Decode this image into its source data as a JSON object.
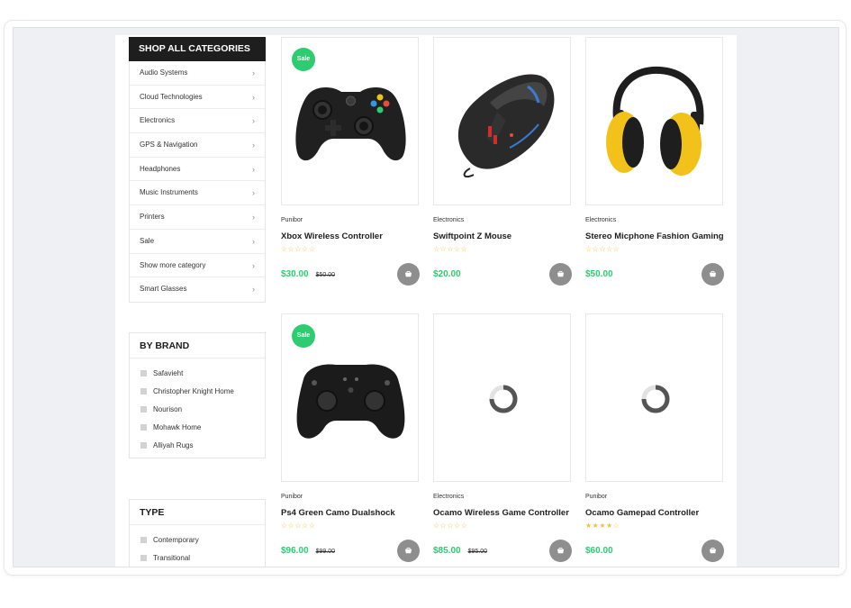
{
  "categories": {
    "title": "SHOP ALL CATEGORIES",
    "items": [
      {
        "label": "Audio Systems"
      },
      {
        "label": "Cloud Technologies"
      },
      {
        "label": "Electronics"
      },
      {
        "label": "GPS & Navigation"
      },
      {
        "label": "Headphones"
      },
      {
        "label": "Music Instruments"
      },
      {
        "label": "Printers"
      },
      {
        "label": "Sale"
      },
      {
        "label": "Show more category"
      },
      {
        "label": "Smart Glasses"
      }
    ]
  },
  "brand": {
    "title": "BY BRAND",
    "items": [
      {
        "label": "Safavieht"
      },
      {
        "label": "Christopher Knight Home"
      },
      {
        "label": "Nourison"
      },
      {
        "label": "Mohawk Home"
      },
      {
        "label": "Alliyah Rugs"
      }
    ]
  },
  "type": {
    "title": "TYPE",
    "items": [
      {
        "label": "Contemporary"
      },
      {
        "label": "Transitional"
      }
    ]
  },
  "products": [
    {
      "badge": "Sale",
      "brand": "Punibor",
      "title": "Xbox Wireless Controller",
      "stars": "☆☆☆☆☆",
      "rating": 0,
      "price": "$30.00",
      "old_price": "$50.00",
      "image": "xbox-controller"
    },
    {
      "badge": "",
      "brand": "Electronics",
      "title": "Swiftpoint Z Mouse",
      "stars": "☆☆☆☆☆",
      "rating": 0,
      "price": "$20.00",
      "old_price": "",
      "image": "gaming-mouse"
    },
    {
      "badge": "",
      "brand": "Electronics",
      "title": "Stereo Micphone Fashion Gaming",
      "stars": "☆☆☆☆☆",
      "rating": 0,
      "price": "$50.00",
      "old_price": "",
      "image": "headphones"
    },
    {
      "badge": "Sale",
      "brand": "Punibor",
      "title": "Ps4 Green Camo Dualshock",
      "stars": "☆☆☆☆☆",
      "rating": 0,
      "price": "$96.00",
      "old_price": "$99.00",
      "image": "gamepad"
    },
    {
      "badge": "",
      "brand": "Electronics",
      "title": "Ocamo Wireless Game Controller",
      "stars": "☆☆☆☆☆",
      "rating": 0,
      "price": "$85.00",
      "old_price": "$95.00",
      "image": "loading"
    },
    {
      "badge": "",
      "brand": "Punibor",
      "title": "Ocamo Gamepad Controller",
      "stars": "★★★★☆",
      "rating": 4,
      "price": "$60.00",
      "old_price": "",
      "image": "loading"
    }
  ],
  "colors": {
    "accent": "#2ecc71",
    "dark": "#1e1e1e",
    "cart": "#8e8e8e",
    "star": "#f0c040"
  }
}
